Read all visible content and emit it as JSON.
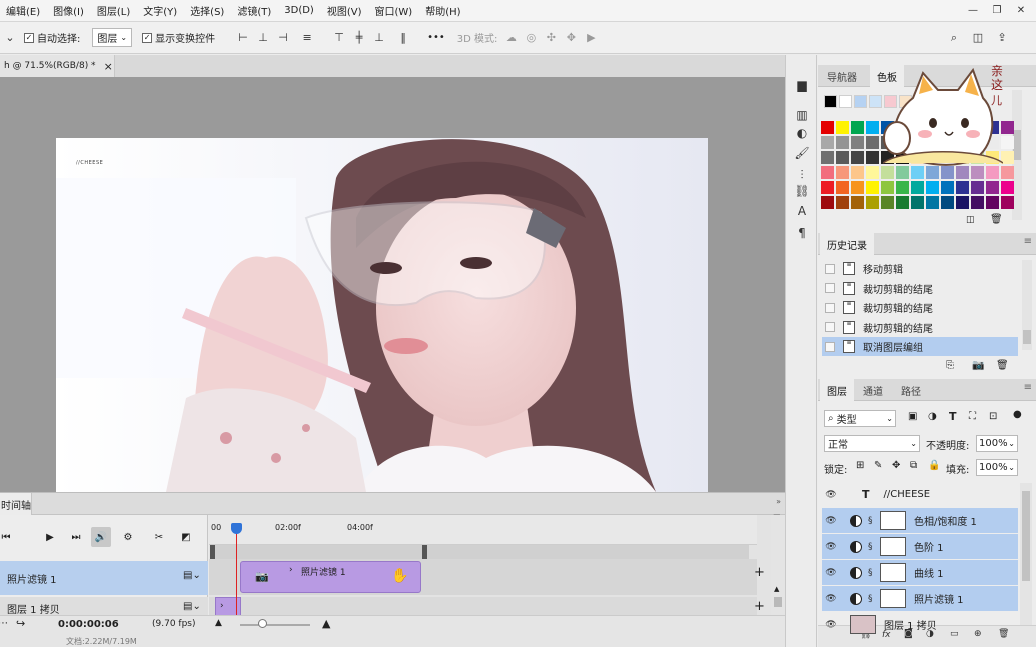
{
  "menubar": {
    "items": [
      "编辑(E)",
      "图像(I)",
      "图层(L)",
      "文字(Y)",
      "选择(S)",
      "滤镜(T)",
      "3D(D)",
      "视图(V)",
      "窗口(W)",
      "帮助(H)"
    ],
    "window_controls": {
      "minimize": "—",
      "restore": "❐",
      "close": "✕"
    }
  },
  "options": {
    "auto_select_label": "自动选择:",
    "auto_select_value": "图层",
    "show_transform_label": "显示变换控件",
    "mode_3d_label": "3D 模式:",
    "more": "•••"
  },
  "document": {
    "tab_title": "h @ 71.5%(RGB/8) *",
    "close": "×",
    "photo_watermark": "//CHEESE"
  },
  "timeline": {
    "tab_label": "时间轴",
    "time_marks": [
      "00",
      "02:00f",
      "04:00f"
    ],
    "tracks": [
      {
        "label": "照片滤镜 1"
      },
      {
        "label": "图层 1 拷贝"
      }
    ],
    "clip_label": "照片滤镜 1",
    "timecode": "0:00:00:06",
    "fps": "(9.70 fps)",
    "status_left": "文档:2.22M/7.19M"
  },
  "navigator_panel": {
    "tabs": [
      "导航器",
      "色板"
    ],
    "active_tab": "色板",
    "sticker_text": [
      "亲",
      "这",
      "儿"
    ]
  },
  "swatches": {
    "top_row": [
      "#000000",
      "#ffffff",
      "#b6d2f2",
      "#cde3f7",
      "#f7c9d0",
      "#f9e3c8"
    ],
    "rows": [
      [
        "#e40000",
        "#fff200",
        "#00a650",
        "#00aeef",
        "#0054a6",
        "#662d91",
        "#ec008c",
        "#ed1c24",
        "#f7941d",
        "#8dc63f",
        "#00a99d",
        "#2e3192",
        "#92278f"
      ],
      [
        "#a8a8a8",
        "#949494",
        "#808080",
        "#6c6c6c",
        "#585858",
        "#444444",
        "#303030",
        "#1c1c1c",
        "#c2c2c2",
        "#d6d6d6",
        "#e0e0e0",
        "#ebebeb",
        "#f5f5f5"
      ],
      [
        "#707070",
        "#5a5a5a",
        "#454545",
        "#333333",
        "#222222",
        "#111111",
        "#ffe3b0",
        "#ffd08a",
        "#ffbb5e",
        "#e6d7a3",
        "#c9e6a6",
        "#ffe97a",
        "#fff1b3"
      ],
      [
        "#f26d7d",
        "#f7977a",
        "#fdc68a",
        "#fff79a",
        "#c4df9b",
        "#82ca9c",
        "#6ecff6",
        "#7ea7d8",
        "#8493ca",
        "#a187be",
        "#bc8dbf",
        "#f49ac1",
        "#f6989d"
      ],
      [
        "#ed1c24",
        "#f26522",
        "#f7941d",
        "#fff200",
        "#8dc63f",
        "#39b54a",
        "#00a99d",
        "#00aeef",
        "#0072bc",
        "#2e3192",
        "#662d91",
        "#92278f",
        "#ec008c"
      ],
      [
        "#9e0b0f",
        "#a0410d",
        "#a36209",
        "#aba000",
        "#598527",
        "#197b30",
        "#00746b",
        "#0076a3",
        "#004a80",
        "#1b1464",
        "#440e62",
        "#630460",
        "#9e005d"
      ]
    ]
  },
  "history_panel": {
    "tab": "历史记录",
    "items": [
      {
        "label": "移动剪辑",
        "selected": false
      },
      {
        "label": "裁切剪辑的结尾",
        "selected": false
      },
      {
        "label": "裁切剪辑的结尾",
        "selected": false
      },
      {
        "label": "裁切剪辑的结尾",
        "selected": false
      },
      {
        "label": "取消图层编组",
        "selected": true
      }
    ]
  },
  "layers_panel": {
    "tabs": [
      "图层",
      "通道",
      "路径"
    ],
    "active_tab": "图层",
    "filter_label": "类型",
    "blend_mode": "正常",
    "opacity_label": "不透明度:",
    "opacity_value": "100%",
    "lock_label": "锁定:",
    "fill_label": "填充:",
    "fill_value": "100%",
    "layers": [
      {
        "name": "//CHEESE",
        "kind": "text",
        "selected": false
      },
      {
        "name": "色相/饱和度 1",
        "kind": "adjustment",
        "selected": true
      },
      {
        "name": "色阶 1",
        "kind": "adjustment",
        "selected": true
      },
      {
        "name": "曲线 1",
        "kind": "adjustment",
        "selected": true
      },
      {
        "name": "照片滤镜 1",
        "kind": "adjustment",
        "selected": true
      },
      {
        "name": "图层 1 拷贝",
        "kind": "pixel",
        "selected": false
      }
    ]
  }
}
